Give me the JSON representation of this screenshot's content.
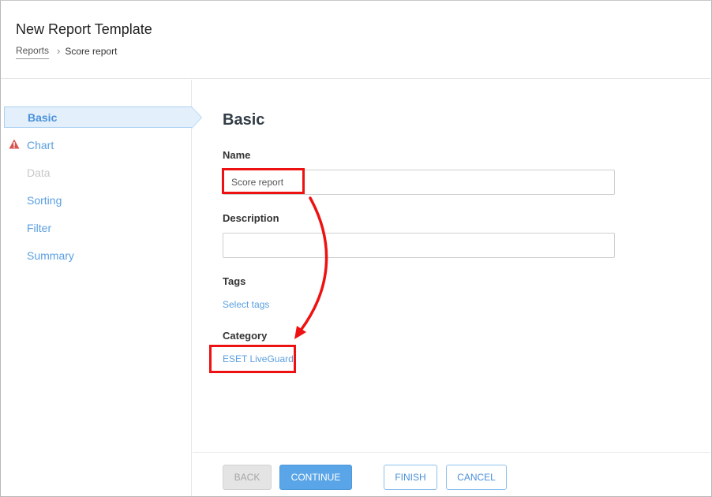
{
  "header": {
    "title": "New Report Template",
    "breadcrumb": [
      {
        "label": "Reports"
      },
      {
        "label": "Score report"
      }
    ],
    "breadcrumb_separator": "›"
  },
  "sidebar": {
    "items": [
      {
        "label": "Basic",
        "state": "active"
      },
      {
        "label": "Chart",
        "state": "warning",
        "icon": "warning-triangle-icon"
      },
      {
        "label": "Data",
        "state": "disabled"
      },
      {
        "label": "Sorting",
        "state": "normal"
      },
      {
        "label": "Filter",
        "state": "normal"
      },
      {
        "label": "Summary",
        "state": "normal"
      }
    ]
  },
  "main": {
    "section_title": "Basic",
    "name": {
      "label": "Name",
      "value": "Score report"
    },
    "description": {
      "label": "Description",
      "value": ""
    },
    "tags": {
      "label": "Tags",
      "link": "Select tags"
    },
    "category": {
      "label": "Category",
      "value": "ESET LiveGuard"
    }
  },
  "footer": {
    "back_label": "BACK",
    "continue_label": "CONTINUE",
    "finish_label": "FINISH",
    "cancel_label": "CANCEL"
  },
  "colors": {
    "accent": "#5aa5e8",
    "link": "#5a9fe0",
    "warning": "#d9534f",
    "annotation": "#ee1111",
    "active_nav_bg": "#e3f0fb"
  }
}
